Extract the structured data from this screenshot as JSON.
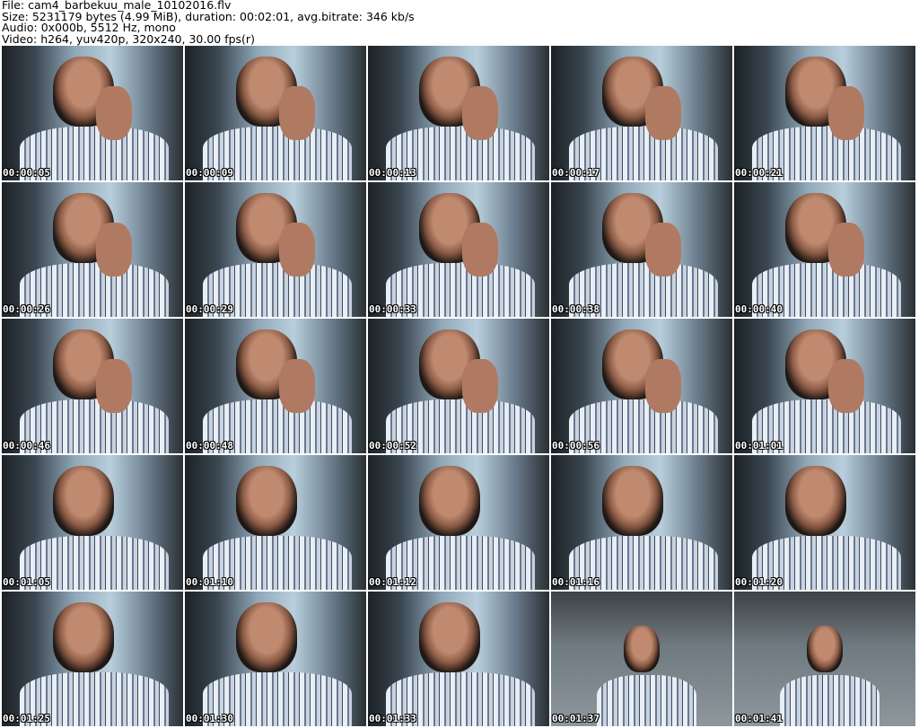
{
  "header": {
    "file": "File: cam4_barbekuu_male_10102016.flv",
    "size": "Size: 5231179 bytes (4.99 MiB), duration: 00:02:01, avg.bitrate: 346 kb/s",
    "audio": "Audio: 0x000b, 5512 Hz, mono",
    "video": "Video: h264, yuv420p, 320x240, 30.00 fps(r)"
  },
  "thumbnails": [
    {
      "time": "00:00:05"
    },
    {
      "time": "00:00:09"
    },
    {
      "time": "00:00:13"
    },
    {
      "time": "00:00:17"
    },
    {
      "time": "00:00:21"
    },
    {
      "time": "00:00:26"
    },
    {
      "time": "00:00:29"
    },
    {
      "time": "00:00:33"
    },
    {
      "time": "00:00:38"
    },
    {
      "time": "00:00:40"
    },
    {
      "time": "00:00:46"
    },
    {
      "time": "00:00:48"
    },
    {
      "time": "00:00:52"
    },
    {
      "time": "00:00:56"
    },
    {
      "time": "00:01:01"
    },
    {
      "time": "00:01:05"
    },
    {
      "time": "00:01:10"
    },
    {
      "time": "00:01:12"
    },
    {
      "time": "00:01:16"
    },
    {
      "time": "00:01:20"
    },
    {
      "time": "00:01:25"
    },
    {
      "time": "00:01:30"
    },
    {
      "time": "00:01:33"
    },
    {
      "time": "00:01:37"
    },
    {
      "time": "00:01:41"
    }
  ]
}
